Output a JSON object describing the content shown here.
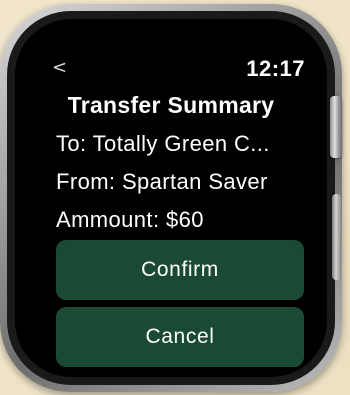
{
  "status_bar": {
    "back_glyph": "<",
    "time": "12:17"
  },
  "summary": {
    "title": "Transfer Summary",
    "to_line": "To: Totally Green C...",
    "from_line": "From: Spartan Saver",
    "amount_line": "Ammount: $60"
  },
  "actions": {
    "confirm_label": "Confirm",
    "cancel_label": "Cancel"
  },
  "colors": {
    "screen_background": "#000000",
    "button_background": "#1a4a33",
    "text": "#ffffff"
  },
  "icons": {
    "back": "chevron-left-icon"
  }
}
